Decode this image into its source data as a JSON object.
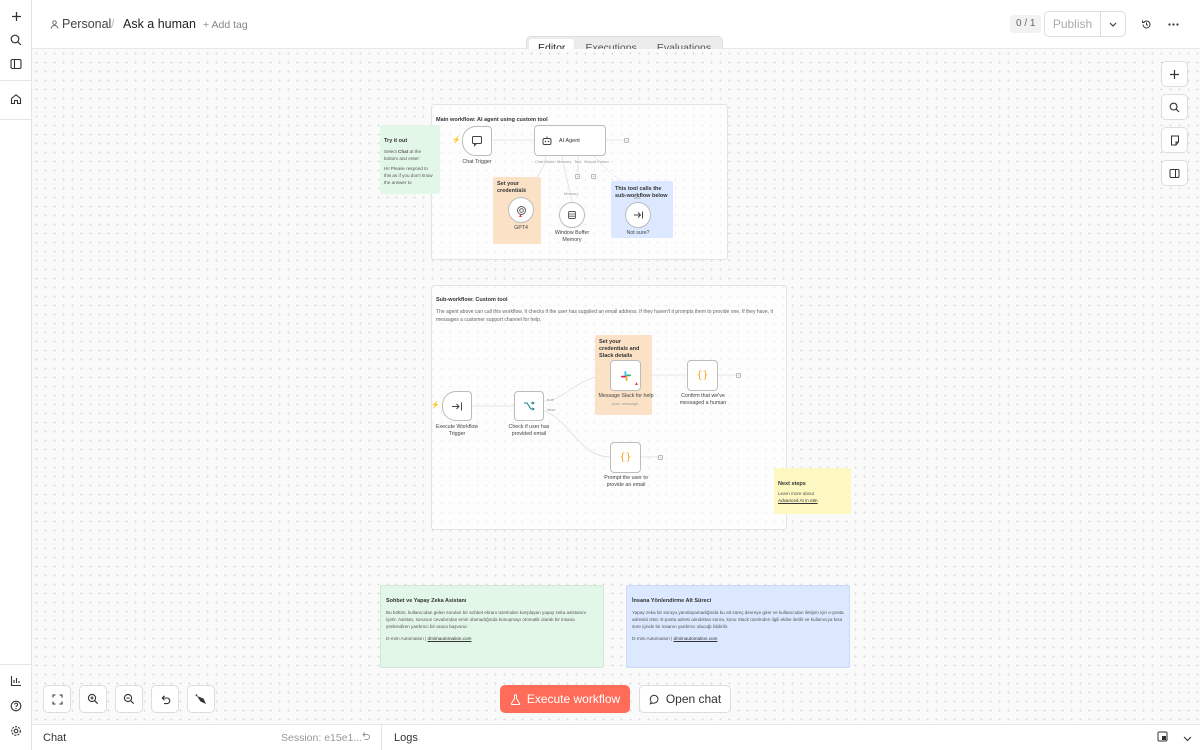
{
  "header": {
    "breadcrumb_project": "Personal",
    "breadcrumb_separator": "/",
    "workflow_name": "Ask a human",
    "add_tag": "+ Add tag",
    "counter": "0 / 1",
    "publish_label": "Publish"
  },
  "tabs": [
    "Editor",
    "Executions",
    "Evaluations"
  ],
  "canvas": {
    "main_group": {
      "title": "Main workflow: AI agent using custom tool",
      "try_note": {
        "title": "Try it out",
        "body_1": "Select ",
        "body_bold": "Chat",
        "body_2": " at the bottom and enter:",
        "body_3": "Hi! Please respond to this as if you don't know the answer to"
      },
      "chat_trigger_label": "Chat Trigger",
      "ai_agent_label": "AI Agent",
      "port_chat_model": "Chat Model",
      "port_memory": "Memory",
      "port_tool": "Tool",
      "port_output_parser": "Output Parser",
      "cred_note": "Set your credentials",
      "model_port_label": "Model",
      "gpt4_label": "GPT4",
      "memory_sub_label": "Memory",
      "memory_label": "Window Buffer Memory",
      "tool_note": "This tool calls the sub-workflow below",
      "tool_sub_label": "Tool",
      "not_sure_label": "Not sure?"
    },
    "sub_group": {
      "title": "Sub-workflow: Custom tool",
      "desc": "The agent above can call this workflow. It checks if the user has supplied an email address. If they haven't it prompts them to provide one. If they have, it messages a customer support channel for help.",
      "exec_trigger_label": "Execute Workflow Trigger",
      "check_label": "Check if user has provided email",
      "true_label": "true",
      "false_label": "false",
      "slack_note": "Set your credentials and Slack details",
      "slack_label": "Message Slack for help",
      "slack_sub": "post: message",
      "confirm_label": "Confirm that we've messaged a human",
      "prompt_label": "Prompt the user to provide an email"
    },
    "next_note": {
      "title": "Next steps",
      "body": "Learn more about",
      "link": "Advanced AI in n8n"
    },
    "tr_note_1": {
      "title": "Sohbet ve Yapay Zeka Asistanı",
      "body": "Bu bölüm, kullanıcıdan gelen soruları bir sohbet ekranı üzerinden karşılayan yapay zeka asistanını içerir. Asistan, sorunun cevabından emin olamadığında konuşmayı otomatik olarak bir insana yönlendiren yardımcı bir araca başvurur.",
      "footer_text": "D-mim Automation | ",
      "footer_link": "dmimautomation.com"
    },
    "tr_note_2": {
      "title": "İnsana Yönlendirme Alt Süreci",
      "body": "Yapay zeka bir soruyu yanıtlayamadığında bu alt süreç devreye girer ve kullanıcıdan iletişim için e-posta adresini ister. E-posta adresi alındıktan sonra, konu Slack üzerinden ilgili ekibe iletilir ve kullanıcıya kısa süre içinde bir insanın yardımcı olacağı bildirilir.",
      "footer_text": "D-mim Automation | ",
      "footer_link": "dmimautomation.com"
    }
  },
  "actions": {
    "execute_label": "Execute workflow",
    "open_chat_label": "Open chat"
  },
  "bottom": {
    "chat_label": "Chat",
    "session_label": "Session: e15e1...",
    "logs_label": "Logs"
  },
  "colors": {
    "accent": "#ff6d5a",
    "note_green": "#e3f7e8",
    "note_orange": "#fbe2c7",
    "note_blue": "#dbe8ff",
    "note_yellow": "#fdf8c2"
  }
}
